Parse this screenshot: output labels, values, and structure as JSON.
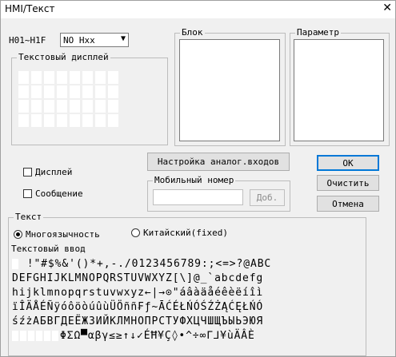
{
  "window": {
    "title": "HMI/Текст",
    "close_icon": "close-icon"
  },
  "range_label": "H01~H1F",
  "combo": {
    "value": "NO Hxx"
  },
  "text_display": {
    "label": "Текстовый дисплей"
  },
  "block": {
    "label": "Блок"
  },
  "parameter": {
    "label": "Параметр"
  },
  "buttons": {
    "analog": "Настройка аналог.входов",
    "ok": "OK",
    "clear": "Очистить",
    "cancel": "Отмена",
    "add": "Доб."
  },
  "checkboxes": {
    "display": "Дисплей",
    "message": "Сообщение"
  },
  "mobile": {
    "label": "Мобильный номер",
    "value": ""
  },
  "text_group": {
    "label": "Текст",
    "multilang": "Многоязычность",
    "chinese": "Китайский(fixed)",
    "selected": "Многоязычность"
  },
  "text_input": {
    "label": "Текстовый ввод",
    "rows": [
      " !\"#$%&'()*+,-./0123456789:;<=>?@ABC",
      "DEFGHIJKLMNOPQRSTUVWXYZ[\\]@_`abcdefg",
      "hijklmnopqrstuvwxyz←|→⊙\"áâàäåéêèëíîì",
      "ïÎÄÅÉÑÿóôöòúûùÜÖññ₣ƒ~ĀĆÉŁŃÓŚŹŻĄĆĘŁŃÓ",
      "śźżАБВГДЕЁЖЗИЙКЛМНОПРСТУФХЦЧШЩЪЫЬЭЮЯ",
      "ΦΣΩ▀αβγ≤≥↑↓✓ÉĦ¥Ç◊•^÷∞Γ⅃¥ùÄÂÈ"
    ]
  }
}
